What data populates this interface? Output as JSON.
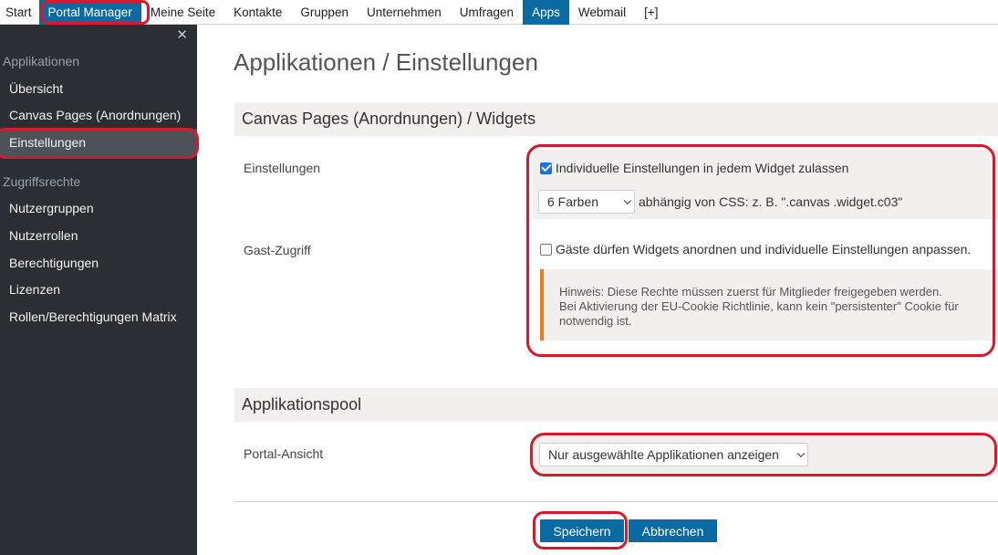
{
  "topnav": {
    "items": [
      "Start",
      "Portal Manager",
      "Meine Seite",
      "Kontakte",
      "Gruppen",
      "Unternehmen",
      "Umfragen",
      "Apps",
      "Webmail",
      "[+]"
    ]
  },
  "sidebar": {
    "close_glyph": "✕",
    "section_applications": "Applikationen",
    "app_items": [
      "Übersicht",
      "Canvas Pages (Anordnungen)",
      "Einstellungen"
    ],
    "section_access": "Zugriffsrechte",
    "access_items": [
      "Nutzergruppen",
      "Nutzerrollen",
      "Berechtigungen",
      "Lizenzen",
      "Rollen/Berechtigungen Matrix"
    ]
  },
  "main": {
    "title": "Applikationen / Einstellungen",
    "canvas_section": {
      "heading": "Canvas Pages (Anordnungen) / Widgets",
      "settings_label": "Einstellungen",
      "individual_settings_checkbox": "Individuelle Einstellungen in jedem Widget zulassen",
      "individual_settings_checked": true,
      "color_select_value": "6 Farben",
      "color_hint": "abhängig von CSS: z. B. \".canvas .widget.c03\"",
      "guest_label": "Gast-Zugriff",
      "guest_checkbox": "Gäste dürfen Widgets anordnen und individuelle Einstellungen anpassen.",
      "guest_checked": false,
      "notice_line1": "Hinweis: Diese Rechte müssen zuerst für Mitglieder freigegeben werden.",
      "notice_line2": "Bei Aktivierung der EU-Cookie Richtlinie, kann kein \"persistenter\" Cookie für",
      "notice_line3": "notwendig ist."
    },
    "pool_section": {
      "heading": "Applikationspool",
      "portal_view_label": "Portal-Ansicht",
      "portal_view_value": "Nur ausgewählte Applikationen anzeigen"
    },
    "buttons": {
      "save": "Speichern",
      "cancel": "Abbrechen"
    }
  },
  "colors": {
    "nav_active": "#0a6aa1",
    "sidebar_bg": "#2b2f33",
    "sidebar_active": "#4d5258",
    "panel_bg": "#f1f0ee",
    "notice_accent": "#f07a1a",
    "annotation_red": "#d9182b",
    "checkbox_blue": "#1a73d6"
  }
}
